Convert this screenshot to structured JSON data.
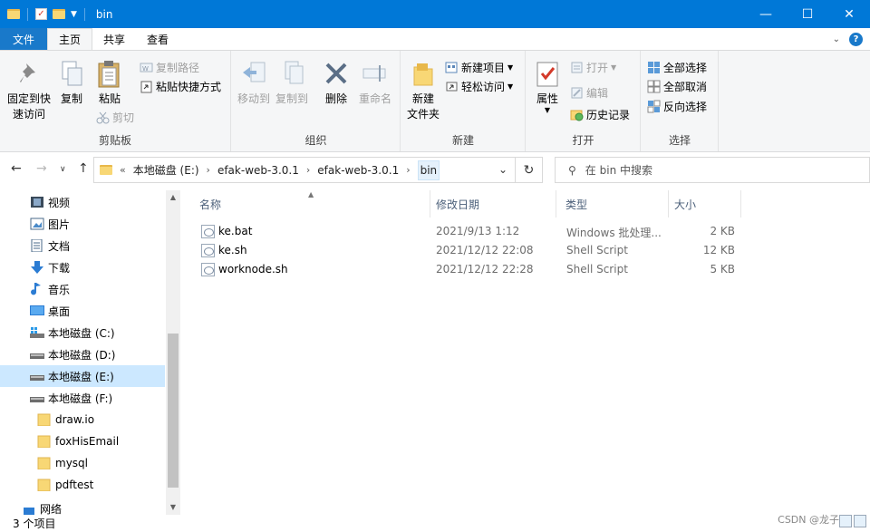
{
  "window": {
    "title": "bin",
    "minimize": "—",
    "maximize": "☐",
    "close": "✕"
  },
  "tabs": [
    {
      "label": "文件"
    },
    {
      "label": "主页"
    },
    {
      "label": "共享"
    },
    {
      "label": "查看"
    }
  ],
  "help": {
    "expand": "⌄",
    "help": "?"
  },
  "ribbon": {
    "clipboard": {
      "title": "剪贴板",
      "pin_line1": "固定到快",
      "pin_line2": "速访问",
      "copy": "复制",
      "paste": "粘贴",
      "copy_path": "复制路径",
      "paste_shortcut": "粘贴快捷方式",
      "cut": "剪切"
    },
    "organize": {
      "title": "组织",
      "move_to": "移动到",
      "copy_to": "复制到",
      "delete": "删除",
      "rename": "重命名"
    },
    "new": {
      "title": "新建",
      "new_folder_line1": "新建",
      "new_folder_line2": "文件夹",
      "new_item": "新建项目",
      "easy_access": "轻松访问"
    },
    "open": {
      "title": "打开",
      "properties": "属性",
      "open": "打开",
      "edit": "编辑",
      "history": "历史记录"
    },
    "select": {
      "title": "选择",
      "select_all": "全部选择",
      "select_none": "全部取消",
      "invert": "反向选择"
    }
  },
  "address": {
    "prefix": "«",
    "segments": [
      "本地磁盘 (E:)",
      "efak-web-3.0.1",
      "efak-web-3.0.1",
      "bin"
    ],
    "search_placeholder": "在 bin 中搜索"
  },
  "nav": [
    {
      "label": "视频",
      "icon": "video-icon"
    },
    {
      "label": "图片",
      "icon": "pictures-icon"
    },
    {
      "label": "文档",
      "icon": "documents-icon"
    },
    {
      "label": "下载",
      "icon": "download-icon"
    },
    {
      "label": "音乐",
      "icon": "music-icon"
    },
    {
      "label": "桌面",
      "icon": "desktop-icon"
    },
    {
      "label": "本地磁盘 (C:)",
      "icon": "drive-c-icon"
    },
    {
      "label": "本地磁盘 (D:)",
      "icon": "drive-icon"
    },
    {
      "label": "本地磁盘 (E:)",
      "icon": "drive-icon",
      "selected": true
    },
    {
      "label": "本地磁盘 (F:)",
      "icon": "drive-icon"
    },
    {
      "label": "draw.io",
      "icon": "folder-icon"
    },
    {
      "label": "foxHisEmail",
      "icon": "folder-icon"
    },
    {
      "label": "mysql",
      "icon": "folder-icon"
    },
    {
      "label": "pdftest",
      "icon": "folder-icon"
    },
    {
      "label": "网络",
      "icon": "network-icon"
    }
  ],
  "columns": {
    "name": "名称",
    "modified": "修改日期",
    "type": "类型",
    "size": "大小"
  },
  "files": [
    {
      "name": "ke.bat",
      "modified": "2021/9/13 1:12",
      "type": "Windows 批处理...",
      "size": "2 KB"
    },
    {
      "name": "ke.sh",
      "modified": "2021/12/12 22:08",
      "type": "Shell Script",
      "size": "12 KB"
    },
    {
      "name": "worknode.sh",
      "modified": "2021/12/12 22:28",
      "type": "Shell Script",
      "size": "5 KB"
    }
  ],
  "status": {
    "count": "3 个项目"
  },
  "watermark": "CSDN @龙子",
  "colors": {
    "accent": "#0078d7",
    "file_tab": "#1979ca",
    "selection": "#cce8ff"
  }
}
